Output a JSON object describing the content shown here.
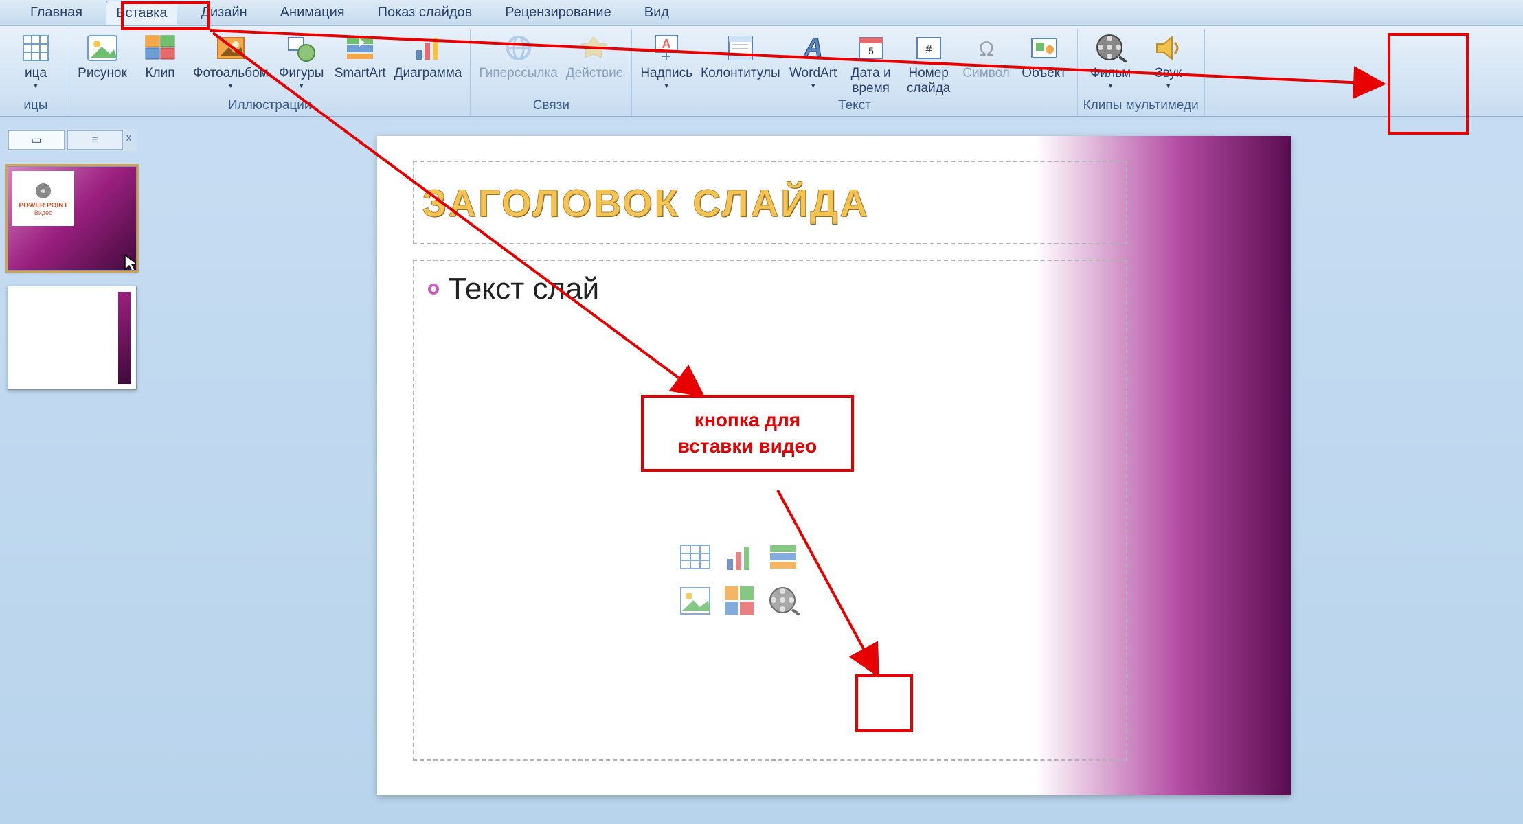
{
  "tabs": {
    "home": "Главная",
    "insert": "Вставка",
    "design": "Дизайн",
    "animation": "Анимация",
    "slideshow": "Показ слайдов",
    "review": "Рецензирование",
    "view": "Вид"
  },
  "ribbon": {
    "groups": {
      "tables": {
        "title": "ицы",
        "table": "ица"
      },
      "illustrations": {
        "title": "Иллюстрации",
        "picture": "Рисунок",
        "clip": "Клип",
        "photoalbum": "Фотоальбом",
        "shapes": "Фигуры",
        "smartart": "SmartArt",
        "chart": "Диаграмма"
      },
      "links": {
        "title": "Связи",
        "hyperlink": "Гиперссылка",
        "action": "Действие"
      },
      "text": {
        "title": "Текст",
        "textbox": "Надпись",
        "headerfooter": "Колонтитулы",
        "wordart": "WordArt",
        "datetime": "Дата и\nвремя",
        "slidenum": "Номер\nслайда",
        "symbol": "Символ",
        "object": "Объект"
      },
      "media": {
        "title": "Клипы мультимеди",
        "movie": "Фильм",
        "sound": "Звук"
      }
    }
  },
  "slide": {
    "title_text": "ЗАГОЛОВОК СЛАЙДА",
    "body_text": "Текст слай"
  },
  "thumb_pane": {
    "tab_slides_glyph": "▭",
    "tab_outline_glyph": "≡",
    "close_glyph": "x",
    "thumb1_badge_line1": "POWER POINT",
    "thumb1_badge_line2": "Видео"
  },
  "annotation": {
    "callout_line1": "кнопка для",
    "callout_line2": "вставки видео"
  }
}
